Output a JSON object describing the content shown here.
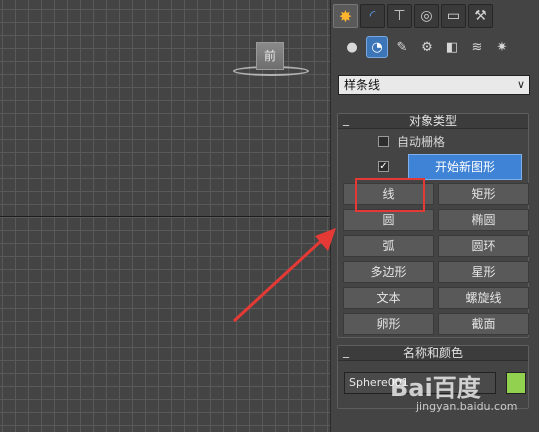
{
  "viewport": {
    "label": "前"
  },
  "panel": {
    "tabs": [
      {
        "icon": "create-icon",
        "glyph": "✸",
        "active": true
      },
      {
        "icon": "modify-icon",
        "glyph": "◜",
        "active": false
      },
      {
        "icon": "hierarchy-icon",
        "glyph": "⊤",
        "active": false
      },
      {
        "icon": "motion-icon",
        "glyph": "◎",
        "active": false
      },
      {
        "icon": "display-icon",
        "glyph": "▭",
        "active": false
      },
      {
        "icon": "utilities-icon",
        "glyph": "⚒",
        "active": false
      }
    ],
    "categories": [
      {
        "icon": "geometry-icon",
        "glyph": "●"
      },
      {
        "icon": "shapes-icon",
        "glyph": "◔",
        "active": true
      },
      {
        "icon": "lights-icon",
        "glyph": "✎"
      },
      {
        "icon": "cameras-icon",
        "glyph": "⚙"
      },
      {
        "icon": "helpers-icon",
        "glyph": "◧"
      },
      {
        "icon": "spacewarps-icon",
        "glyph": "≋"
      },
      {
        "icon": "systems-icon",
        "glyph": "✷"
      }
    ],
    "dropdown_value": "样条线",
    "object_type": {
      "title": "对象类型",
      "autogrid_label": "自动栅格",
      "start_new_shape_label": "开始新图形",
      "buttons": [
        "线",
        "矩形",
        "圆",
        "椭圆",
        "弧",
        "圆环",
        "多边形",
        "星形",
        "文本",
        "螺旋线",
        "卵形",
        "截面"
      ]
    },
    "name_color": {
      "title": "名称和颜色",
      "name_value": "Sphere001",
      "color": "#92d050"
    }
  },
  "watermark": {
    "brand": "Bai百度",
    "url": "jingyan.baidu.com"
  },
  "colors": {
    "accent": "#3f83d6",
    "annotation": "#e53935"
  }
}
